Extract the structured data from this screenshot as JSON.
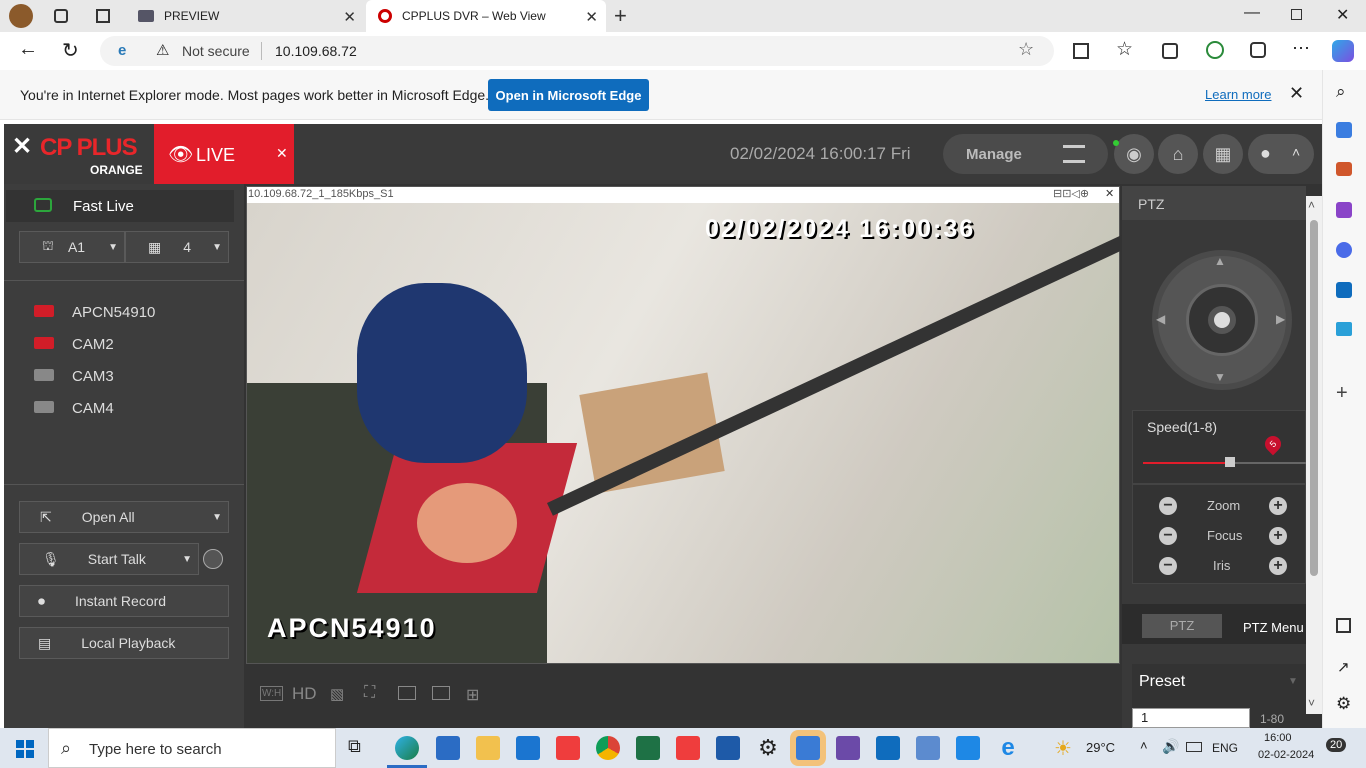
{
  "browser": {
    "tab1": "PREVIEW",
    "tab2": "CPPLUS DVR – Web View",
    "not_secure": "Not secure",
    "url": "10.109.68.72",
    "ie_message": "You're in Internet Explorer mode. Most pages work better in Microsoft Edge.",
    "open_edge": "Open in Microsoft Edge",
    "learn_more": "Learn more"
  },
  "app": {
    "brand": "CP PLUS",
    "brand_sub": "ORANGE",
    "live_label": "LIVE",
    "datetime": "02/02/2024 16:00:17 Fri",
    "manage": "Manage"
  },
  "left": {
    "fast_live": "Fast Live",
    "channel_group": "A1",
    "split": "4",
    "cameras": [
      "APCN54910",
      "CAM2",
      "CAM3",
      "CAM4"
    ],
    "open_all": "Open All",
    "start_talk": "Start Talk",
    "instant_record": "Instant Record",
    "local_playback": "Local Playback"
  },
  "video": {
    "stream_info": "10.109.68.72_1_185Kbps_S1",
    "osd_time": "02/02/2024 16:00:36",
    "osd_name": "APCN54910",
    "hd": "HD",
    "wh": "W:H"
  },
  "ptz": {
    "title": "PTZ",
    "speed_label": "Speed(1-8)",
    "speed_value": "5",
    "zoom": "Zoom",
    "focus": "Focus",
    "iris": "Iris",
    "tab_ptz": "PTZ",
    "tab_menu": "PTZ Menu",
    "preset": "Preset",
    "preset_num": "1",
    "preset_range": "1-80"
  },
  "taskbar": {
    "search": "Type here to search",
    "temp": "29°C",
    "lang": "ENG",
    "time": "16:00",
    "date": "02-02-2024",
    "notif": "20"
  }
}
